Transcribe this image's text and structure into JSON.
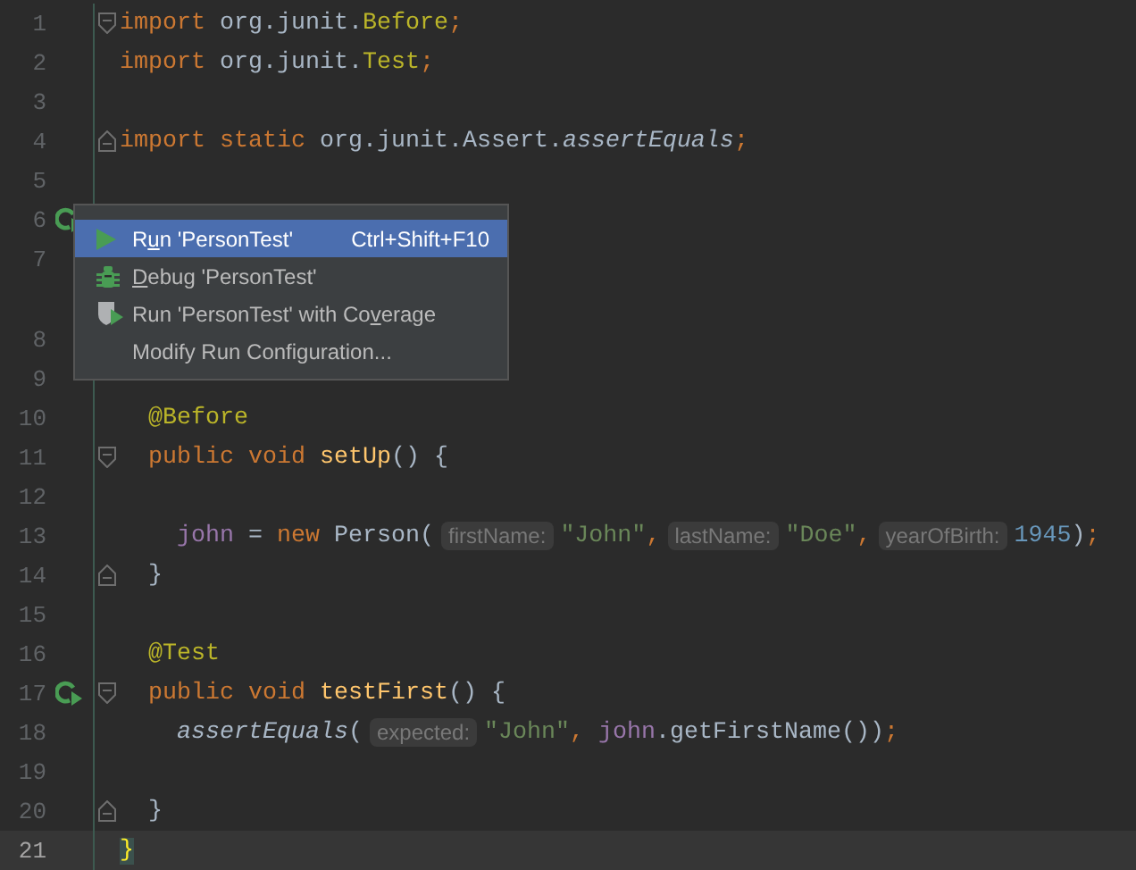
{
  "editor": {
    "lines": [
      {
        "number": "1",
        "run_icon": false,
        "fold_open": true,
        "fold_close": false,
        "current": false,
        "tokens": [
          {
            "kind": "kw",
            "text": "import"
          },
          {
            "kind": "plain",
            "text": " org.junit."
          },
          {
            "kind": "ann",
            "text": "Before"
          },
          {
            "kind": "kw",
            "text": ";"
          }
        ]
      },
      {
        "number": "2",
        "run_icon": false,
        "fold_open": false,
        "fold_close": false,
        "current": false,
        "tokens": [
          {
            "kind": "kw",
            "text": "import"
          },
          {
            "kind": "plain",
            "text": " org.junit."
          },
          {
            "kind": "ann",
            "text": "Test"
          },
          {
            "kind": "kw",
            "text": ";"
          }
        ]
      },
      {
        "number": "3",
        "run_icon": false,
        "fold_open": false,
        "fold_close": false,
        "current": false
      },
      {
        "number": "4",
        "run_icon": false,
        "fold_open": false,
        "fold_close": true,
        "current": false,
        "tokens": [
          {
            "kind": "kw",
            "text": "import static"
          },
          {
            "kind": "plain",
            "text": " org.junit.Assert."
          },
          {
            "kind": "static",
            "text": "assertEquals"
          },
          {
            "kind": "kw",
            "text": ";"
          }
        ]
      },
      {
        "number": "5",
        "run_icon": false,
        "fold_open": false,
        "fold_close": false,
        "current": false
      },
      {
        "number": "6",
        "run_icon": true,
        "fold_open": false,
        "fold_close": false,
        "current": false
      },
      {
        "number": "7",
        "run_icon": false,
        "fold_open": false,
        "fold_close": false,
        "current": false
      },
      {
        "number": "8",
        "run_icon": false,
        "fold_open": false,
        "fold_close": false,
        "current": false
      },
      {
        "number": "9",
        "run_icon": false,
        "fold_open": false,
        "fold_close": false,
        "current": false
      },
      {
        "number": "10",
        "run_icon": false,
        "fold_open": false,
        "fold_close": false,
        "current": false,
        "tokens": [
          {
            "kind": "ann",
            "text": "  @Before"
          }
        ]
      },
      {
        "number": "11",
        "run_icon": false,
        "fold_open": true,
        "fold_close": false,
        "current": false,
        "tokens": [
          {
            "kind": "kw",
            "text": "  public void"
          },
          {
            "kind": "method",
            "text": " setUp"
          },
          {
            "kind": "plain",
            "text": "() {"
          }
        ]
      },
      {
        "number": "12",
        "run_icon": false,
        "fold_open": false,
        "fold_close": false,
        "current": false
      },
      {
        "number": "13",
        "run_icon": false,
        "fold_open": false,
        "fold_close": false,
        "current": false,
        "tokens": [
          {
            "kind": "field",
            "text": "    john"
          },
          {
            "kind": "plain",
            "text": " = "
          },
          {
            "kind": "kw",
            "text": "new"
          },
          {
            "kind": "plain",
            "text": " Person("
          },
          {
            "kind": "hint",
            "text": "firstName:"
          },
          {
            "kind": "str",
            "text": "\"John\""
          },
          {
            "kind": "kw",
            "text": ","
          },
          {
            "kind": "hint",
            "text": "lastName:"
          },
          {
            "kind": "str",
            "text": "\"Doe\""
          },
          {
            "kind": "kw",
            "text": ","
          },
          {
            "kind": "hint",
            "text": "yearOfBirth:"
          },
          {
            "kind": "num",
            "text": "1945"
          },
          {
            "kind": "plain",
            "text": ")"
          },
          {
            "kind": "kw",
            "text": ";"
          }
        ]
      },
      {
        "number": "14",
        "run_icon": false,
        "fold_open": false,
        "fold_close": true,
        "current": false,
        "tokens": [
          {
            "kind": "plain",
            "text": "  }"
          }
        ]
      },
      {
        "number": "15",
        "run_icon": false,
        "fold_open": false,
        "fold_close": false,
        "current": false
      },
      {
        "number": "16",
        "run_icon": false,
        "fold_open": false,
        "fold_close": false,
        "current": false,
        "tokens": [
          {
            "kind": "ann",
            "text": "  @Test"
          }
        ]
      },
      {
        "number": "17",
        "run_icon": true,
        "fold_open": true,
        "fold_close": false,
        "current": false,
        "tokens": [
          {
            "kind": "kw",
            "text": "  public void"
          },
          {
            "kind": "method",
            "text": " testFirst"
          },
          {
            "kind": "plain",
            "text": "() {"
          }
        ]
      },
      {
        "number": "18",
        "run_icon": false,
        "fold_open": false,
        "fold_close": false,
        "current": false,
        "tokens": [
          {
            "kind": "static",
            "text": "    assertEquals"
          },
          {
            "kind": "plain",
            "text": "("
          },
          {
            "kind": "hint",
            "text": "expected:"
          },
          {
            "kind": "str",
            "text": "\"John\""
          },
          {
            "kind": "kw",
            "text": ","
          },
          {
            "kind": "field",
            "text": " john"
          },
          {
            "kind": "plain",
            "text": ".getFirstName())"
          },
          {
            "kind": "kw",
            "text": ";"
          }
        ]
      },
      {
        "number": "19",
        "run_icon": false,
        "fold_open": false,
        "fold_close": false,
        "current": false
      },
      {
        "number": "20",
        "run_icon": false,
        "fold_open": false,
        "fold_close": true,
        "current": false,
        "tokens": [
          {
            "kind": "plain",
            "text": "  }"
          }
        ]
      },
      {
        "number": "21",
        "run_icon": false,
        "fold_open": false,
        "fold_close": false,
        "current": true,
        "tokens": [
          {
            "kind": "brace",
            "text": "}"
          }
        ]
      }
    ]
  },
  "popup_menu": {
    "items": [
      {
        "kind": "run",
        "selected": true,
        "label_before": "R",
        "mnemonic": "u",
        "label_after": "n 'PersonTest'",
        "shortcut": "Ctrl+Shift+F10"
      },
      {
        "kind": "debug",
        "selected": false,
        "mnemonic": "D",
        "label_after": "ebug 'PersonTest'"
      },
      {
        "kind": "coverage",
        "selected": false,
        "label_before": "Run 'PersonTest' with Co",
        "mnemonic": "v",
        "label_after": "erage"
      },
      {
        "kind": "none",
        "selected": false,
        "label_before": "Modify Run Configuration..."
      }
    ]
  }
}
